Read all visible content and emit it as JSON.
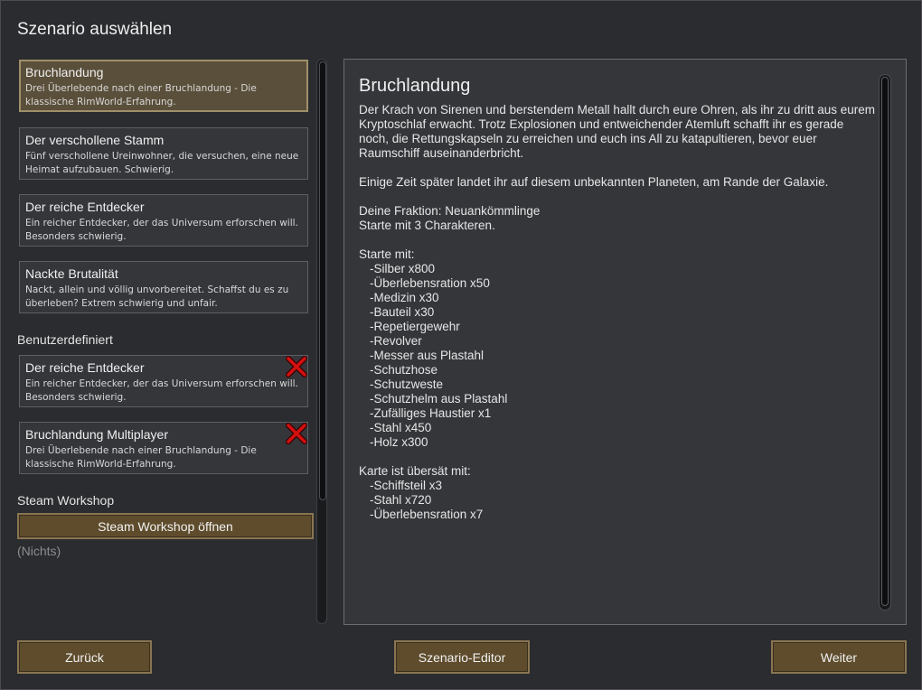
{
  "window": {
    "title": "Szenario auswählen"
  },
  "scenarios_builtin": [
    {
      "name": "Bruchlandung",
      "desc": "Drei Überlebende nach einer Bruchlandung - Die klassische RimWorld-Erfahrung.",
      "selected": true
    },
    {
      "name": "Der verschollene Stamm",
      "desc": "Fünf verschollene Ureinwohner, die versuchen, eine neue Heimat aufzubauen. Schwierig."
    },
    {
      "name": "Der reiche Entdecker",
      "desc": "Ein reicher Entdecker, der das Universum erforschen will. Besonders schwierig."
    },
    {
      "name": "Nackte Brutalität",
      "desc": "Nackt, allein und völlig unvorbereitet. Schaffst du es zu überleben? Extrem schwierig und unfair."
    }
  ],
  "custom_section_label": "Benutzerdefiniert",
  "scenarios_custom": [
    {
      "name": "Der reiche Entdecker",
      "desc": "Ein reicher Entdecker, der das Universum erforschen will. Besonders schwierig."
    },
    {
      "name": "Bruchlandung Multiplayer",
      "desc": "Drei Überlebende nach einer Bruchlandung - Die klassische RimWorld-Erfahrung."
    }
  ],
  "workshop": {
    "label": "Steam Workshop",
    "button": "Steam Workshop öffnen",
    "empty": "(Nichts)"
  },
  "detail": {
    "title": "Bruchlandung",
    "intro": "Der Krach von Sirenen und berstendem Metall hallt durch eure Ohren, als ihr zu dritt aus eurem Kryptoschlaf erwacht. Trotz Explosionen und entweichender Atemluft schafft ihr es gerade noch, die Rettungskapseln zu erreichen und euch ins All zu katapultieren, bevor euer Raumschiff auseinanderbricht.",
    "landing": "Einige Zeit später landet ihr auf diesem unbekannten Planeten, am Rande der Galaxie.",
    "faction": "Deine Fraktion: Neuankömmlinge",
    "start_count": "Starte mit 3 Charakteren.",
    "start_with_label": "Starte mit:",
    "start_items": [
      "-Silber x800",
      "-Überlebensration x50",
      "-Medizin x30",
      "-Bauteil x30",
      "-Repetiergewehr",
      "-Revolver",
      "-Messer aus Plastahl",
      "-Schutzhose",
      "-Schutzweste",
      "-Schutzhelm aus Plastahl",
      "-Zufälliges Haustier x1",
      "-Stahl x450",
      "-Holz x300"
    ],
    "map_label": "Karte ist übersät mit:",
    "map_items": [
      "-Schiffsteil x3",
      "-Stahl x720",
      "-Überlebensration x7"
    ]
  },
  "buttons": {
    "back": "Zurück",
    "editor": "Szenario-Editor",
    "next": "Weiter"
  },
  "colors": {
    "accent": "#5e4c2c",
    "selected": "#5a4f3a",
    "delete": "#d21010"
  }
}
